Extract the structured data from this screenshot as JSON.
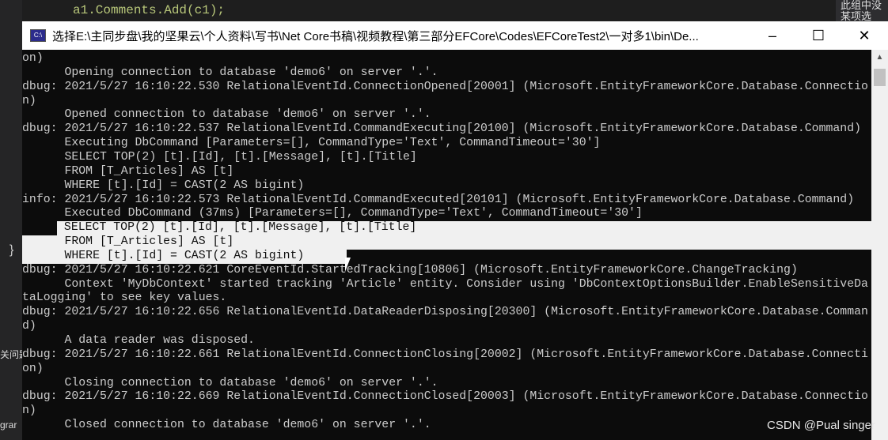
{
  "editor": {
    "code_line": "a1.Comments.Add(c1);",
    "right_panel_text": "此组中没 某项选",
    "left_labels": [
      "}",
      "关问题",
      "grar"
    ]
  },
  "window": {
    "icon_label": "C:\\",
    "title": "选择E:\\主同步盘\\我的坚果云\\个人资料\\写书\\Net Core书稿\\视频教程\\第三部分EFCore\\Codes\\EFCoreTest2\\一对多1\\bin\\De...",
    "minimize": "–",
    "maximize": "☐",
    "close": "✕"
  },
  "console": {
    "lines": [
      {
        "text": "on)"
      },
      {
        "text": "      Opening connection to database 'demo6' on server '.'."
      },
      {
        "text": "dbug: 2021/5/27 16:10:22.530 RelationalEventId.ConnectionOpened[20001] (Microsoft.EntityFrameworkCore.Database.Connectio"
      },
      {
        "text": "n)"
      },
      {
        "text": "      Opened connection to database 'demo6' on server '.'."
      },
      {
        "text": "dbug: 2021/5/27 16:10:22.537 RelationalEventId.CommandExecuting[20100] (Microsoft.EntityFrameworkCore.Database.Command)"
      },
      {
        "text": "      Executing DbCommand [Parameters=[], CommandType='Text', CommandTimeout='30']"
      },
      {
        "text": "      SELECT TOP(2) [t].[Id], [t].[Message], [t].[Title]"
      },
      {
        "text": "      FROM [T_Articles] AS [t]"
      },
      {
        "text": "      WHERE [t].[Id] = CAST(2 AS bigint)"
      },
      {
        "text": "info: 2021/5/27 16:10:22.573 RelationalEventId.CommandExecuted[20101] (Microsoft.EntityFrameworkCore.Database.Command)"
      },
      {
        "text": "      Executed DbCommand (37ms) [Parameters=[], CommandType='Text', CommandTimeout='30']"
      },
      {
        "text": "      SELECT TOP(2) [t].[Id], [t].[Message], [t].[Title]",
        "selected": "partial-start"
      },
      {
        "text": "      FROM [T_Articles] AS [t]",
        "selected": "full"
      },
      {
        "text": "      WHERE [t].[Id] = CAST(2 AS bigint)",
        "selected": "end"
      },
      {
        "text": "dbug: 2021/5/27 16:10:22.621 CoreEventId.StartedTracking[10806] (Microsoft.EntityFrameworkCore.ChangeTracking)"
      },
      {
        "text": "      Context 'MyDbContext' started tracking 'Article' entity. Consider using 'DbContextOptionsBuilder.EnableSensitiveDa"
      },
      {
        "text": "taLogging' to see key values."
      },
      {
        "text": "dbug: 2021/5/27 16:10:22.656 RelationalEventId.DataReaderDisposing[20300] (Microsoft.EntityFrameworkCore.Database.Comman"
      },
      {
        "text": "d)"
      },
      {
        "text": "      A data reader was disposed."
      },
      {
        "text": "dbug: 2021/5/27 16:10:22.661 RelationalEventId.ConnectionClosing[20002] (Microsoft.EntityFrameworkCore.Database.Connecti"
      },
      {
        "text": "on)"
      },
      {
        "text": "      Closing connection to database 'demo6' on server '.'."
      },
      {
        "text": "dbug: 2021/5/27 16:10:22.669 RelationalEventId.ConnectionClosed[20003] (Microsoft.EntityFrameworkCore.Database.Connectio"
      },
      {
        "text": "n)"
      },
      {
        "text": "      Closed connection to database 'demo6' on server '.'."
      }
    ]
  },
  "watermark": "CSDN @Pual singer"
}
